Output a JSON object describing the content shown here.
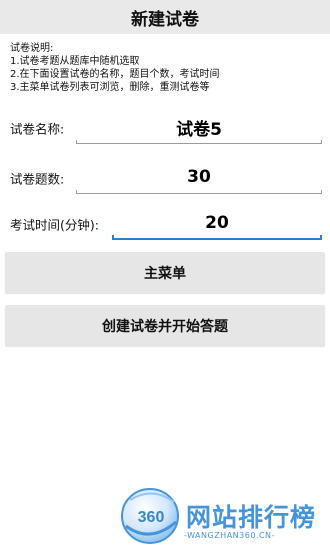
{
  "header": {
    "title": "新建试卷"
  },
  "instructions": {
    "lines": [
      "试卷说明:",
      "1.试卷考题从题库中随机选取",
      "2.在下面设置试卷的名称，题目个数，考试时间",
      "3.主菜单试卷列表可浏览，删除，重测试卷等"
    ]
  },
  "form": {
    "name_label": "试卷名称:",
    "name_value": "试卷5",
    "count_label": "试卷题数:",
    "count_value": "30",
    "time_label": "考试时间(分钟):",
    "time_value": "20"
  },
  "buttons": {
    "main_menu": "主菜单",
    "create": "创建试卷并开始答题"
  },
  "watermark": {
    "logo_text": "360",
    "site_name": "网站排行榜",
    "site_url": "-WANGZHAN360.CN-"
  },
  "colors": {
    "accent": "#2f7fc6",
    "watermark": "#3d8fd8"
  }
}
